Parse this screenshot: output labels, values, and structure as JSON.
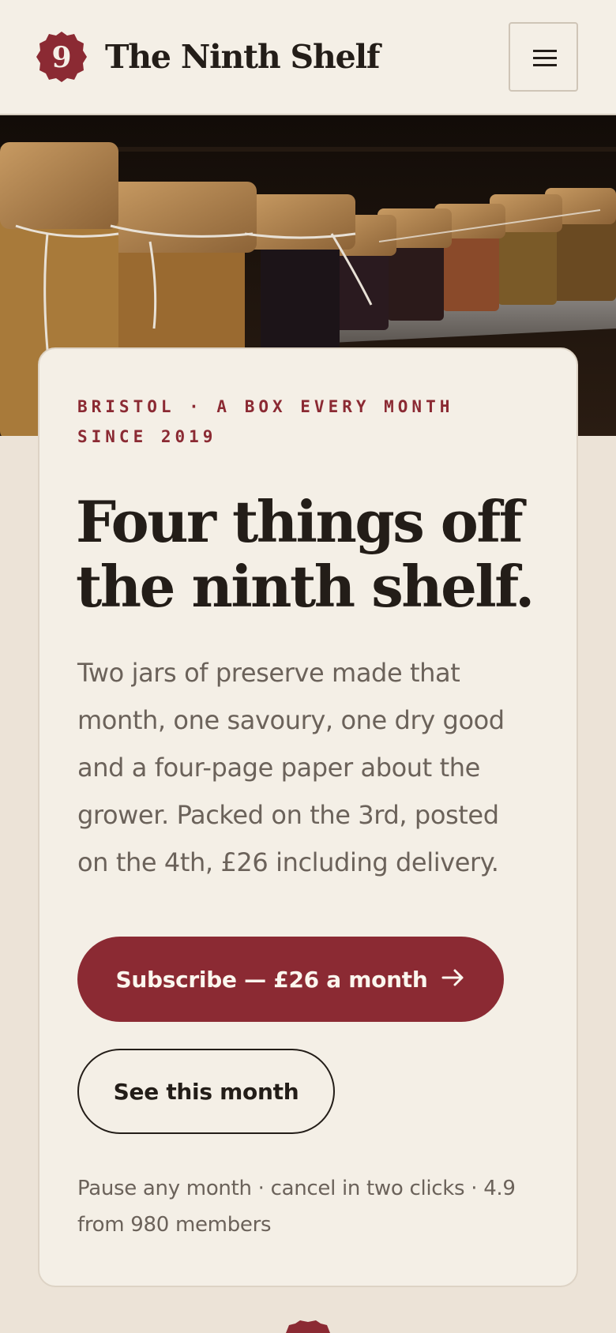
{
  "brand": {
    "logo_glyph": "9",
    "name": "The Ninth Shelf",
    "accent_color": "#8b2a33"
  },
  "header": {
    "menu_icon": "hamburger-menu-icon"
  },
  "hero": {
    "image_subject": "jars-of-preserves-on-shelf"
  },
  "card": {
    "eyebrow": "Bristol · A box every month since 2019",
    "headline": "Four things off the ninth shelf.",
    "lede": "Two jars of preserve made that month, one savoury, one dry good and a four-page paper about the grower. Packed on the 3rd, posted on the 4th, £26 including delivery.",
    "primary_cta": "Subscribe — £26 a month",
    "primary_cta_icon": "arrow-right-icon",
    "secondary_cta": "See this month",
    "fine_print": "Pause any month · cancel in two clicks · 4.9 from 980 members"
  }
}
